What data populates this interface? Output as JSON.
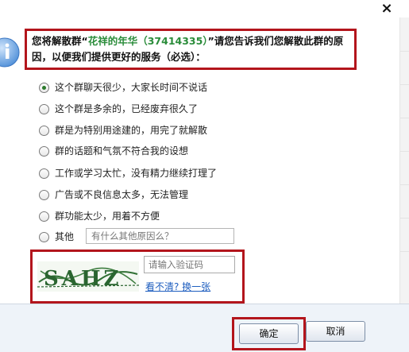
{
  "dialog": {
    "close_symbol": "×",
    "message_prefix": "您将解散群“",
    "group_name": "花祥的年华",
    "group_id": "（37414335）",
    "message_suffix": "”请您告诉我们您解散此群的原因，以便我们提供更好的服务（必选）：",
    "icon": "info-icon"
  },
  "reasons": [
    {
      "label": "这个群聊天很少，大家长时间不说话",
      "checked": true
    },
    {
      "label": "这个群是多余的，已经废弃很久了",
      "checked": false
    },
    {
      "label": "群是为特别用途建的，用完了就解散",
      "checked": false
    },
    {
      "label": "群的话题和气氛不符合我的设想",
      "checked": false
    },
    {
      "label": "工作或学习太忙，没有精力继续打理了",
      "checked": false
    },
    {
      "label": "广告或不良信息太多，无法管理",
      "checked": false
    },
    {
      "label": "群功能太少，用着不方便",
      "checked": false
    },
    {
      "label": "其他",
      "checked": false
    }
  ],
  "other_input": {
    "placeholder": "有什么其他原因么？"
  },
  "captcha": {
    "image_text": "SAHZ",
    "placeholder": "请输入验证码",
    "refresh_link": "看不清? 换一张"
  },
  "buttons": {
    "ok": "确定",
    "cancel": "取消"
  },
  "colors": {
    "highlight_border": "#b3151c",
    "group_name": "#2a8c3a",
    "link": "#1d5dbf"
  }
}
